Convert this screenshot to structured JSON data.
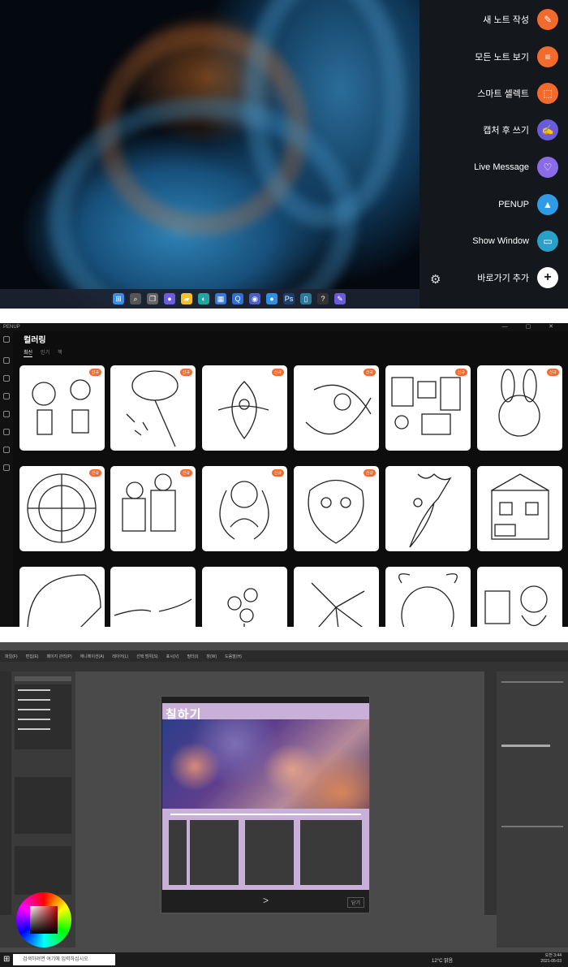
{
  "galaxy_tab": {
    "air_command_items": [
      {
        "label": "새 노트 작성",
        "icon": "note-plus-icon",
        "glyph": "✎",
        "color": "#f26a2c"
      },
      {
        "label": "모든 노트 보기",
        "icon": "notes-icon",
        "glyph": "≡",
        "color": "#f26a2c"
      },
      {
        "label": "스마트 셀렉트",
        "icon": "smart-select-icon",
        "glyph": "⬚",
        "color": "#f26a2c"
      },
      {
        "label": "캡처 후 쓰기",
        "icon": "screen-write-icon",
        "glyph": "✍",
        "color": "#6a5cd9"
      },
      {
        "label": "Live Message",
        "icon": "live-message-icon",
        "glyph": "♡",
        "color": "#8a6ce8"
      },
      {
        "label": "PENUP",
        "icon": "penup-icon",
        "glyph": "▲",
        "color": "#2f9be8"
      },
      {
        "label": "Show Window",
        "icon": "show-window-icon",
        "glyph": "▭",
        "color": "#2aa0c8"
      },
      {
        "label": "바로가기 추가",
        "icon": "add-shortcut-icon",
        "glyph": "+",
        "color": "#ffffff"
      }
    ],
    "taskbar_icons": [
      {
        "name": "start-icon",
        "glyph": "⊞",
        "color": "#3a8ee8"
      },
      {
        "name": "search-icon",
        "glyph": "⌕",
        "color": "#555"
      },
      {
        "name": "task-view-icon",
        "glyph": "❐",
        "color": "#666"
      },
      {
        "name": "chat-icon",
        "glyph": "●",
        "color": "#6b5ce0"
      },
      {
        "name": "file-explorer-icon",
        "glyph": "▰",
        "color": "#f2c12e"
      },
      {
        "name": "edge-icon",
        "glyph": "◐",
        "color": "#1fa6a0"
      },
      {
        "name": "store-icon",
        "glyph": "▦",
        "color": "#3a78d8"
      },
      {
        "name": "search-app-icon",
        "glyph": "Q",
        "color": "#2f6fd8"
      },
      {
        "name": "circle-app-icon",
        "glyph": "◉",
        "color": "#4a60c8"
      },
      {
        "name": "blue-app-icon",
        "glyph": "●",
        "color": "#2f8fe0"
      },
      {
        "name": "photoshop-icon",
        "glyph": "Ps",
        "color": "#1b3f70"
      },
      {
        "name": "tablet-icon",
        "glyph": "▯",
        "color": "#2a7a9a"
      },
      {
        "name": "clip-studio-icon",
        "glyph": "?",
        "color": "#333"
      },
      {
        "name": "pen-app-icon",
        "glyph": "✎",
        "color": "#6a5cd9"
      }
    ]
  },
  "penup": {
    "app_name": "PENUP",
    "page_title": "컬러링",
    "tabs": [
      "최신",
      "인기",
      "책"
    ],
    "badge_label": "신규",
    "window_controls": "— ▢ ✕"
  },
  "clip_studio": {
    "menu_items": [
      "파일(F)",
      "편집(E)",
      "페이지 관리(P)",
      "애니메이션(A)",
      "레이어(L)",
      "선택 범위(S)",
      "표시(V)",
      "필터(I)",
      "창(W)",
      "도움말(H)"
    ],
    "dialog_title": "칠하기",
    "search_placeholder": "검색하려면 여기에 입력하십시오",
    "weather": "12°C 맑음",
    "time": "오전 3:44",
    "date": "2021-05-03",
    "nav_next": ">",
    "close_label": "닫기"
  }
}
